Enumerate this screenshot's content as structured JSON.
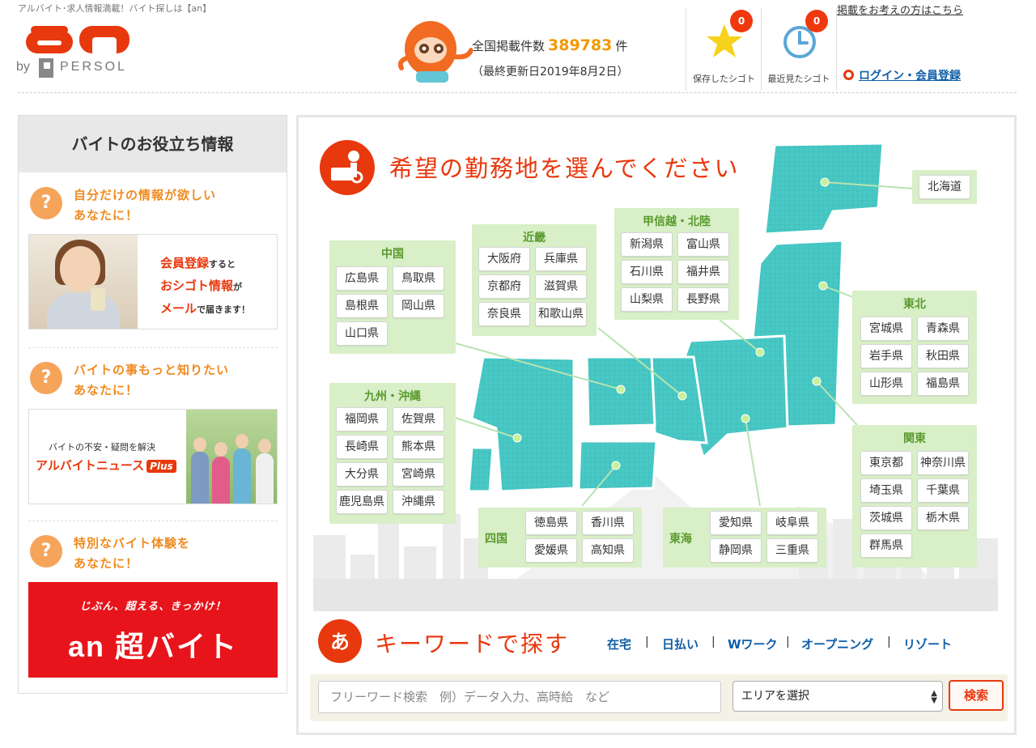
{
  "header": {
    "tagline": "アルバイト･求人情報満載！バイト探しは【an】",
    "logo": {
      "brand": "an",
      "by": "by",
      "company": "PERSOL"
    },
    "count_prefix": "全国掲載件数",
    "count_value": "389783",
    "count_suffix": "件",
    "update_text": "（最終更新日2019年8月2日）",
    "saved_label": "保存したシゴト",
    "saved_count": "0",
    "recent_label": "最近見たシゴト",
    "recent_count": "0",
    "advertiser_link": "掲載をお考えの方はこちら",
    "login_link": "ログイン・会員登録"
  },
  "sidebar": {
    "title": "バイトのお役立ち情報",
    "tips": [
      {
        "text": "自分だけの情報が欲しい\nあなたに！"
      },
      {
        "text": "バイトの事もっと知りたい\nあなたに！"
      },
      {
        "text": "特別なバイト体験を\nあなたに！"
      }
    ],
    "banner1": {
      "line1_a": "会員登録",
      "line1_b": "すると",
      "line2_a": "おシゴト情報",
      "line2_b": "が",
      "line3_a": "メール",
      "line3_b": "で届きます！"
    },
    "banner2": {
      "line1": "バイトの不安・疑問を解決",
      "line2": "アルバイトニュース",
      "plus": "Plus"
    },
    "banner3": {
      "line1": "じぶん、超える、きっかけ！",
      "line2": "an 超バイト"
    }
  },
  "map": {
    "title": "希望の勤務地を選んでください",
    "map_color": "#48c9c6",
    "region_color": "#d8efc7",
    "regions": [
      {
        "name": "北海道",
        "prefs": []
      },
      {
        "name": "中国",
        "prefs": [
          "広島県",
          "鳥取県",
          "島根県",
          "岡山県",
          "山口県"
        ]
      },
      {
        "name": "近畿",
        "prefs": [
          "大阪府",
          "兵庫県",
          "京都府",
          "滋賀県",
          "奈良県",
          "和歌山県"
        ]
      },
      {
        "name": "甲信越・北陸",
        "prefs": [
          "新潟県",
          "富山県",
          "石川県",
          "福井県",
          "山梨県",
          "長野県"
        ]
      },
      {
        "name": "東北",
        "prefs": [
          "宮城県",
          "青森県",
          "岩手県",
          "秋田県",
          "山形県",
          "福島県"
        ]
      },
      {
        "name": "九州・沖縄",
        "prefs": [
          "福岡県",
          "佐賀県",
          "長崎県",
          "熊本県",
          "大分県",
          "宮崎県",
          "鹿児島県",
          "沖縄県"
        ]
      },
      {
        "name": "関東",
        "prefs": [
          "東京都",
          "神奈川県",
          "埼玉県",
          "千葉県",
          "茨城県",
          "栃木県",
          "群馬県"
        ]
      },
      {
        "name": "四国",
        "prefs": [
          "徳島県",
          "香川県",
          "愛媛県",
          "高知県"
        ]
      },
      {
        "name": "東海",
        "prefs": [
          "愛知県",
          "岐阜県",
          "静岡県",
          "三重県"
        ]
      }
    ]
  },
  "keyword": {
    "icon_char": "あ",
    "title": "キーワードで探す",
    "links": [
      "在宅",
      "日払い",
      "Wワーク",
      "オープニング",
      "リゾート"
    ],
    "separator": "|",
    "search_placeholder": "フリーワード検索　例）データ入力、高時給　など",
    "area_select": "エリアを選択",
    "search_button": "検索"
  },
  "colors": {
    "accent": "#e8380d",
    "orange": "#f39800",
    "link": "#0f5ea8"
  }
}
